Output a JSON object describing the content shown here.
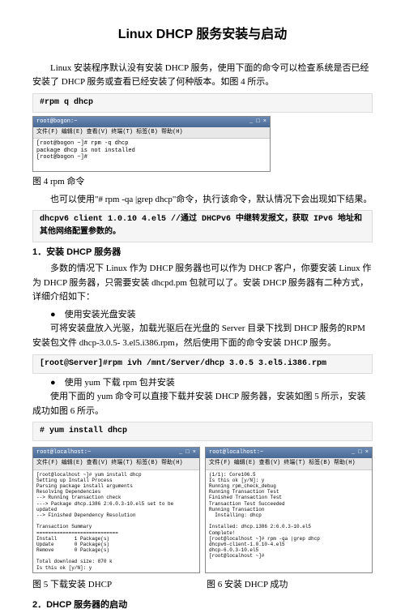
{
  "title": "Linux    DHCP 服务安装与启动",
  "intro": "Linux 安装程序默认没有安装 DHCP 服务，使用下面的命令可以检查系统是否已经安装了 DHCP 服务或查看已经安装了何种版本。如图 4 所示。",
  "cmd1": "#rpm  q dhcp",
  "term1": {
    "title": "root@bogon:~",
    "menu": "文件(F)  编辑(E)  查看(V)  终端(T)  标签(B)  帮助(H)",
    "body": "[root@bogon ~]# rpm -q dhcp\npackage dhcp is not installed\n[root@bogon ~]#"
  },
  "fig4": "图 4    rpm 命令",
  "para2": "也可以使用\"# rpm -qa |grep dhcp\"命令，执行该命令，默认情况下会出现如下结果。",
  "cmd2": "dhcpv6 client 1.0.10 4.el5 //通过 DHCPv6 中继转发报文，获取 IPv6 地址和其他网络配置参数的。",
  "sec1": "1．安装 DHCP 服务器",
  "para3": "多数的情况下 Linux 作为 DHCP 服务器也可以作为 DHCP 客户，你要安装 Linux 作为 DHCP 服务器，只需要安装 dhcpd.pm 包就可以了。安装 DHCP 服务器有二种方式，详细介绍如下：",
  "bullet1": "●　使用安装光盘安装",
  "para4": "可将安装盘放入光驱，加载光驱后在光盘的 Server 目录下找到 DHCP 服务的RPM 安装包文件 dhcp-3.0.5- 3.el5.i386.rpm，然后使用下面的命令安装 DHCP 服务。",
  "cmd3": "[root@Server]#rpm  ivh /mnt/Server/dhcp 3.0.5 3.el5.i386.rpm",
  "bullet2": "●　使用 yum 下载 rpm 包并安装",
  "para5": "使用下面的 yum 命令可以直接下载并安装 DHCP 服务器，安装如图 5 所示，安装成功如图 6 所示。",
  "cmd4": "# yum install dhcp",
  "term5": {
    "title": "root@localhost:~",
    "menu": "文件(F)  编辑(E)  查看(V)  终端(T)  标签(B)  帮助(H)",
    "body": "[root@localhost ~]# yum install dhcp\nSetting up Install Process\nParsing package install arguments\nResolving Dependencies\n--> Running transaction check\n---> Package dhcp.i386 2:6.0.3-10.el5 set to be updated\n--> Finished Dependency Resolution\n\nTransaction Summary\n============================\nInstall      1 Package(s)\nUpdate       0 Package(s)\nRemove       0 Package(s)\n\nTotal download size: 870 k\nIs this ok [y/N]: y"
  },
  "term6": {
    "title": "root@localhost:~",
    "menu": "文件(F)  编辑(E)  查看(V)  终端(T)  标签(B)  帮助(H)",
    "body": "(1/1): Core106.5\nIs this ok [y/N]: y\nRunning rpm_check_debug\nRunning Transaction Test\nFinished Transaction Test\nTransaction Test Succeeded\nRunning Transaction\n  Installing: dhcp\n\nInstalled: dhcp.i386 2:6.0.3-10.el5\nComplete!\n[root@localhost ~]# rpm -qa |grep dhcp\ndhcpv6-client-1.0.10-4.el5\ndhcp-6.0.3-10.el5\n[root@localhost ~]#"
  },
  "fig5": "图 5    下载安装 DHCP",
  "fig6": "图 6    安装 DHCP 成功",
  "sec2": "2．DHCP 服务器的启动"
}
